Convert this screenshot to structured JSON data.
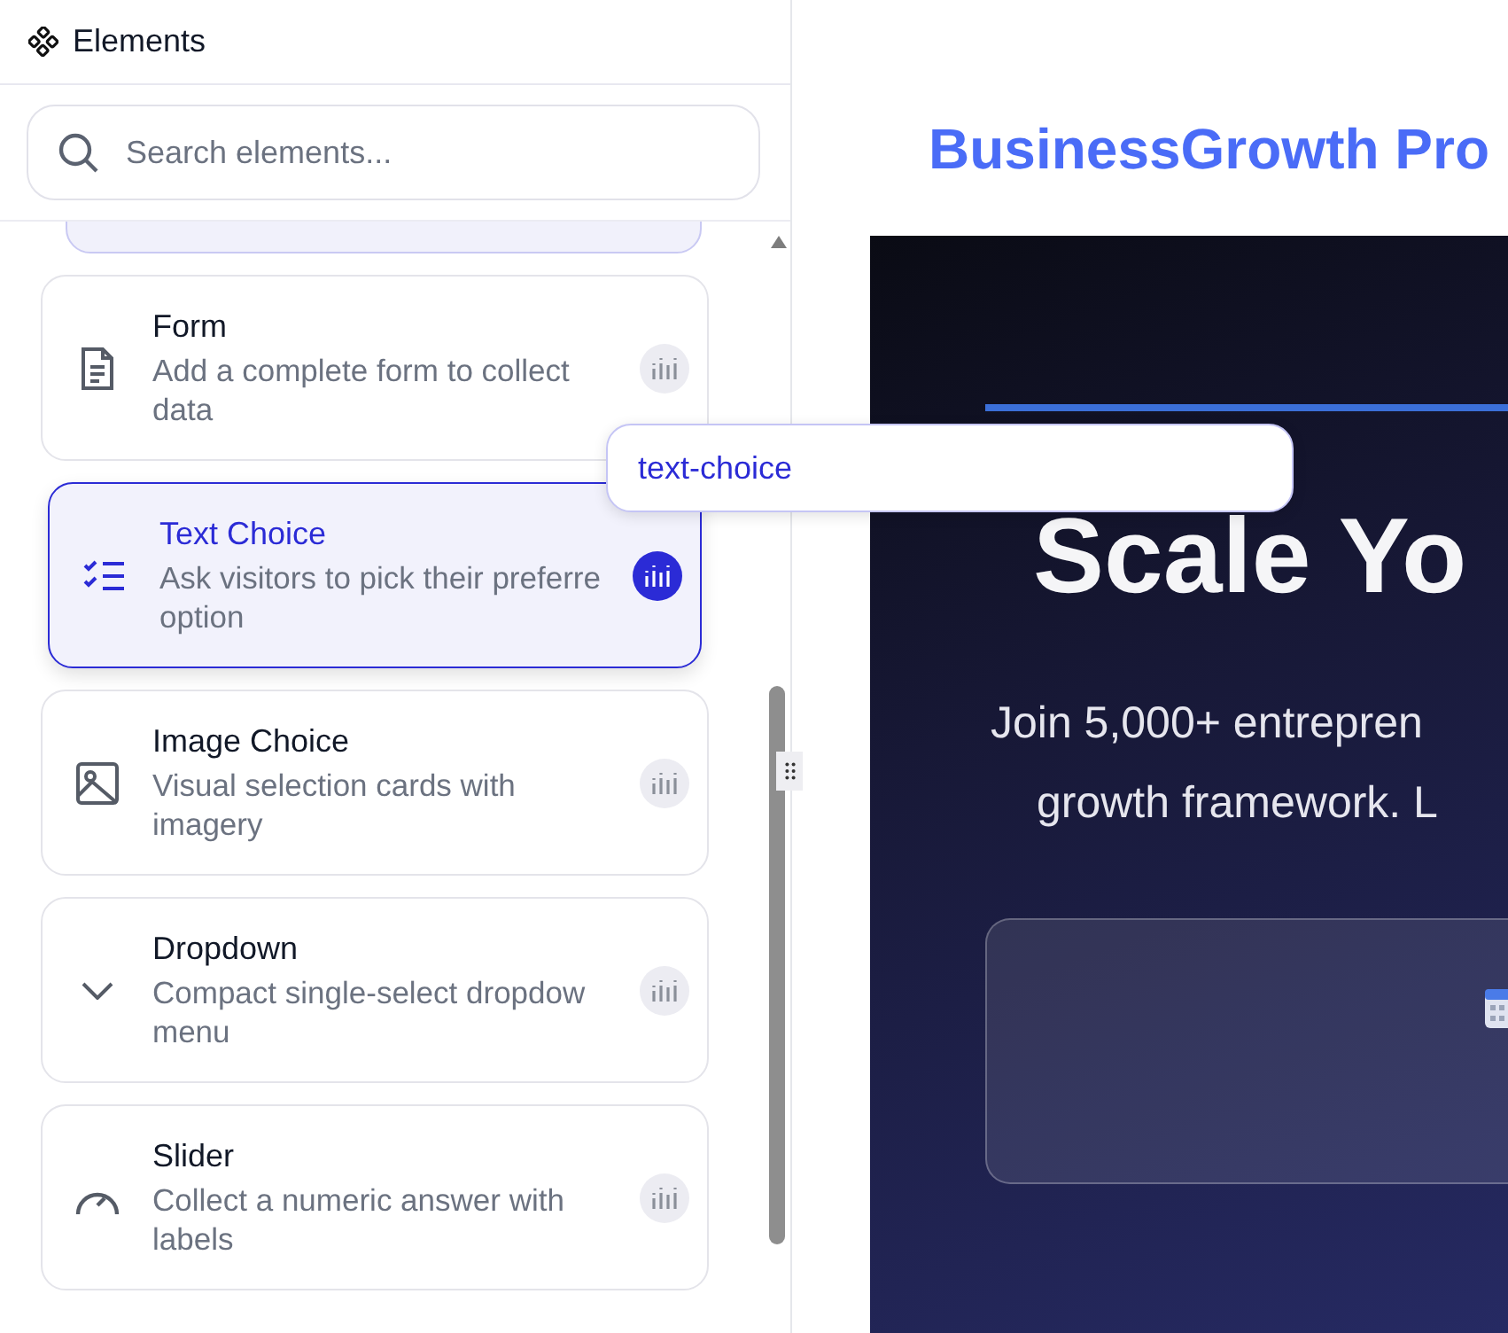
{
  "panel": {
    "title": "Elements",
    "search": {
      "placeholder": "Search elements..."
    },
    "items": [
      {
        "kind": "form",
        "title": "Form",
        "lines": [
          "Add a complete form to collect",
          "data"
        ],
        "selected": false
      },
      {
        "kind": "text-choice",
        "title": "Text Choice",
        "lines": [
          "Ask visitors to pick their preferre",
          "option"
        ],
        "selected": true
      },
      {
        "kind": "image-choice",
        "title": "Image Choice",
        "lines": [
          "Visual selection cards with",
          "imagery"
        ],
        "selected": false
      },
      {
        "kind": "dropdown",
        "title": "Dropdown",
        "lines": [
          "Compact single-select dropdow",
          "menu"
        ],
        "selected": false
      },
      {
        "kind": "slider",
        "title": "Slider",
        "lines": [
          "Collect a numeric answer with",
          "labels"
        ],
        "selected": false
      }
    ]
  },
  "tooltip": {
    "text": "text-choice"
  },
  "preview": {
    "brand": "BusinessGrowth Pro",
    "heading": "Scale Yo",
    "lines": [
      "Join 5,000+ entrepren",
      "growth framework. L"
    ]
  }
}
